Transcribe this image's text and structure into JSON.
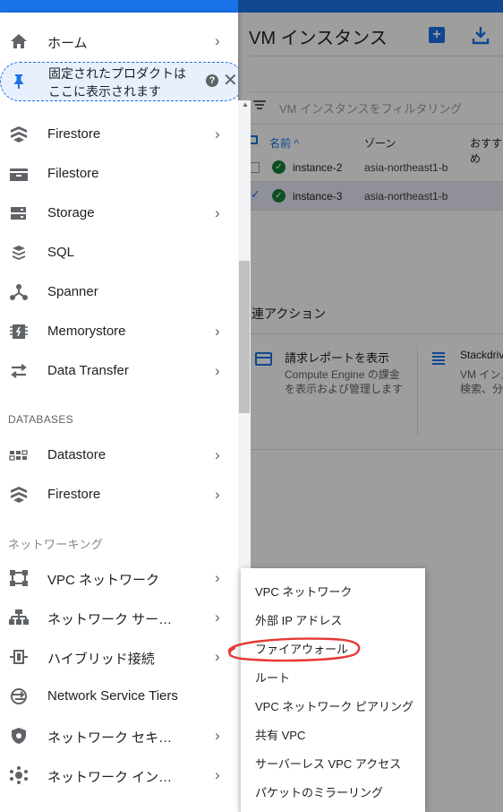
{
  "page": {
    "title": "VM インスタンス"
  },
  "toolbar": {
    "create_icon": "add-box-icon",
    "import_icon": "download-icon"
  },
  "filter": {
    "placeholder": "VM インスタンスをフィルタリング"
  },
  "table": {
    "headers": [
      "名前 ^",
      "ゾーン",
      "おすすめ"
    ],
    "rows": [
      {
        "name": "instance-2",
        "zone": "asia-northeast1-b",
        "status": "ok",
        "selected": false
      },
      {
        "name": "instance-3",
        "zone": "asia-northeast1-b",
        "status": "ok",
        "selected": true
      }
    ]
  },
  "related": {
    "heading": "連アクション",
    "cards": [
      {
        "title": "請求レポートを表示",
        "desc_line1": "Compute Engine の課金",
        "desc_line2": "を表示および管理します",
        "icon": "credit-card-icon"
      },
      {
        "title": "Stackdriv",
        "desc_line1": "VM インス",
        "desc_line2": "検索、分",
        "icon": "list-icon"
      }
    ]
  },
  "sidebar": {
    "home": {
      "label": "ホーム",
      "icon": "home-icon"
    },
    "pin_notice": {
      "line1": "固定されたプロダクトは",
      "line2": "ここに表示されます",
      "help": "?",
      "close": "✕"
    },
    "items_storage": [
      {
        "label": "Firestore",
        "icon": "firestore-icon",
        "chevron": true
      },
      {
        "label": "Filestore",
        "icon": "filestore-icon",
        "chevron": false
      },
      {
        "label": "Storage",
        "icon": "storage-icon",
        "chevron": true
      },
      {
        "label": "SQL",
        "icon": "sql-icon",
        "chevron": false
      },
      {
        "label": "Spanner",
        "icon": "spanner-icon",
        "chevron": false
      },
      {
        "label": "Memorystore",
        "icon": "memorystore-icon",
        "chevron": true
      },
      {
        "label": "Data Transfer",
        "icon": "data-transfer-icon",
        "chevron": true
      }
    ],
    "section_databases": "DATABASES",
    "items_databases": [
      {
        "label": "Datastore",
        "icon": "datastore-icon",
        "chevron": true
      },
      {
        "label": "Firestore",
        "icon": "firestore-icon",
        "chevron": true
      }
    ],
    "section_networking": "ネットワーキング",
    "items_networking": [
      {
        "label": "VPC ネットワーク",
        "icon": "vpc-network-icon",
        "chevron": true
      },
      {
        "label": "ネットワーク サー…",
        "icon": "network-services-icon",
        "chevron": true
      },
      {
        "label": "ハイブリッド接続",
        "icon": "hybrid-connectivity-icon",
        "chevron": true
      },
      {
        "label": "Network Service Tiers",
        "icon": "network-tiers-icon",
        "chevron": false
      },
      {
        "label": "ネットワーク セキ…",
        "icon": "network-security-icon",
        "chevron": true
      },
      {
        "label": "ネットワーク イン…",
        "icon": "network-intelligence-icon",
        "chevron": true
      }
    ],
    "chevron": "›"
  },
  "flyout": {
    "items": [
      "VPC ネットワーク",
      "外部 IP アドレス",
      "ファイアウォール",
      "ルート",
      "VPC ネットワーク ピアリング",
      "共有 VPC",
      "サーバーレス VPC アクセス",
      "パケットのミラーリング"
    ],
    "highlighted": "ファイアウォール",
    "annotation_color": "#e53935"
  },
  "colors": {
    "accent": "#1a73e8",
    "ok_green": "#188038",
    "icon_grey": "#5f6368"
  }
}
